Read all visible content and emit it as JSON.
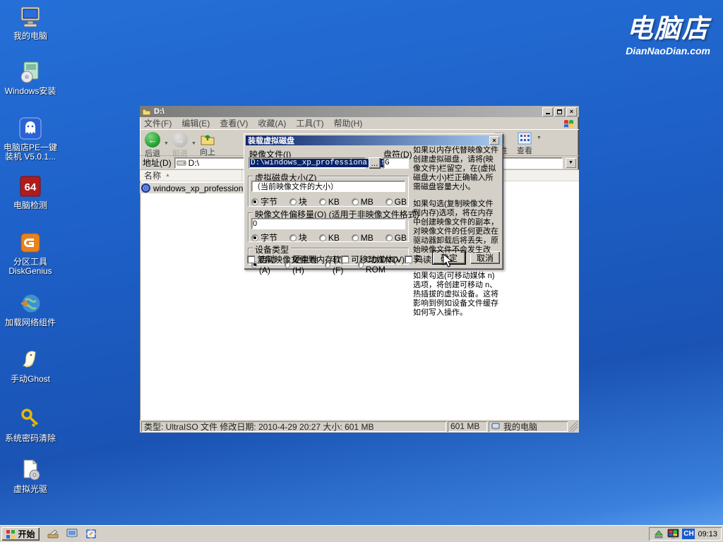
{
  "desktop": {
    "logo": {
      "title": "电脑店",
      "subtitle": "DianNaoDian.com"
    },
    "icons": [
      {
        "label": "我的电脑"
      },
      {
        "label": "Windows安装"
      },
      {
        "label": "电脑店PE一键装机 V5.0.1..."
      },
      {
        "label": "电脑检测"
      },
      {
        "label": "分区工具 DiskGenius"
      },
      {
        "label": "加载网络组件"
      },
      {
        "label": "手动Ghost"
      },
      {
        "label": "系统密码清除"
      },
      {
        "label": "虚拟光驱"
      }
    ]
  },
  "explorer": {
    "title": "D:\\",
    "menus": [
      "文件(F)",
      "编辑(E)",
      "查看(V)",
      "收藏(A)",
      "工具(T)",
      "帮助(H)"
    ],
    "toolbar": {
      "back": "后退",
      "forward": "前进",
      "up": "向上",
      "properties": "属性",
      "view": "查看"
    },
    "address": {
      "label": "地址(D)",
      "value": "D:\\"
    },
    "list": {
      "column_name": "名称",
      "file_name": "windows_xp_professional.iso"
    },
    "statusbar": {
      "details": "类型: UltraISO 文件 修改日期: 2010-4-29 20:27 大小: 601 MB",
      "size": "601 MB",
      "location": "我的电脑"
    }
  },
  "dialog": {
    "title": "装载虚拟磁盘",
    "image_file_label": "映像文件(I)",
    "image_file_value": "D:\\windows_xp_professional.iso",
    "browse_label": "...",
    "drive_label": "盘符(D)",
    "drive_value": "G",
    "size_group_label": "虚拟磁盘大小(Z)",
    "size_value": "（当前映像文件的大小）",
    "units": [
      "字节",
      "块",
      "KB",
      "MB",
      "GB"
    ],
    "offset_group_label": "映像文件偏移量(O)",
    "offset_group_note": "(适用于非映像文件格式)",
    "offset_value": "0",
    "device_group_label": "设备类型",
    "device_options": [
      "自动(A)",
      "硬盘卷(H)",
      "软盘(F)",
      "CD/DVD-ROM"
    ],
    "checkbox_labels": [
      "复制映像文件到内存(T)",
      "可移动媒体(V)",
      "只读媒体(R)"
    ],
    "ok_label": "确定",
    "cancel_label": "取消",
    "help_paragraphs": [
      "如果以内存代替映像文件创建虚拟磁盘，请将(映像文件)栏留空，在(虚拟磁盘大小)栏正确输入所需磁盘容量大小。",
      "如果勾选(复制映像文件到内存)选项，将在内存中创建映像文件的副本，对映像文件的任何更改在驱动器卸载后将丢失，原始映像文件不会发生改变。",
      "如果勾选(可移动媒体 n)选项，将创建可移动 n、热插拔的虚拟设备。这将影响到例如设备文件缓存如何写入操作。"
    ]
  },
  "taskbar": {
    "start_label": "开始",
    "input_indicator": "CH",
    "time": "09:13"
  },
  "glyphs": {
    "close": "×",
    "dropdown": "▼",
    "sort_asc": "▲",
    "back_arrow": "←",
    "fwd_arrow": "→"
  },
  "colors": {
    "title_active_left": "#0a246a",
    "title_active_right": "#a6caf0",
    "desktop_blue": "#1d5fc6",
    "selection_blue": "#0a246a"
  }
}
